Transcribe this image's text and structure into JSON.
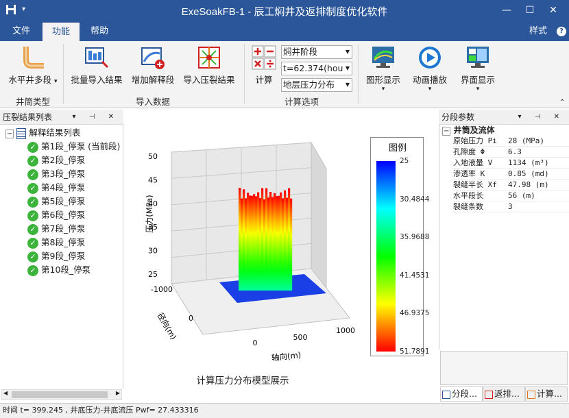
{
  "window": {
    "title": "ExeSoakFB-1 - 辰工焖井及返排制度优化软件",
    "minimize": "—",
    "maximize": "☐",
    "close": "✕",
    "help": "?"
  },
  "menu": {
    "file": "文件",
    "function": "功能",
    "help": "帮助",
    "style": "样式"
  },
  "ribbon": {
    "well_multi": "水平井多段",
    "batch_import": "批量导入结果",
    "add_segment": "增加解释段",
    "import_frac": "导入压裂结果",
    "calc": "计算",
    "graph_show": "图形显示",
    "anim_play": "动画播放",
    "ui_show": "界面显示",
    "group_well_type": "井筒类型",
    "group_import": "导入数据",
    "group_calc_opts": "计算选项",
    "combo_stage": "焖井阶段",
    "combo_time": "t=62.374(hou",
    "combo_field": "地层压力分布"
  },
  "left_panel": {
    "title": "压裂结果列表",
    "root": "解释结果列表",
    "items": [
      "第1段_停泵 (当前段)",
      "第2段_停泵",
      "第3段_停泵",
      "第4段_停泵",
      "第5段_停泵",
      "第6段_停泵",
      "第7段_停泵",
      "第8段_停泵",
      "第9段_停泵",
      "第10段_停泵"
    ]
  },
  "chart_data": {
    "type": "surface3d",
    "title": "计算压力分布模型展示",
    "zlabel": "压力(MPa)",
    "xlabel": "轴向(m)",
    "ylabel": "径向(m)",
    "z_ticks": [
      "50",
      "45",
      "40",
      "35",
      "30",
      "25"
    ],
    "x_ticks": [
      "0",
      "500",
      "1000"
    ],
    "y_ticks": [
      "-1000",
      "0"
    ],
    "zlim": [
      25,
      51.7891
    ],
    "legend_title": "图例",
    "legend_values": [
      "25",
      "30.4844",
      "35.9688",
      "41.4531",
      "46.9375",
      "51.7891"
    ],
    "colormap": [
      "#0000ff",
      "#00ffff",
      "#00ff00",
      "#ffff00",
      "#ff0000"
    ],
    "baseline_color": "#1a3fe6",
    "peak_pressure": 51.7891,
    "base_pressure": 25
  },
  "right_panel": {
    "title": "分段参数",
    "section": "井筒及流体",
    "rows": [
      {
        "name": "原始压力 Pi",
        "value": "28 (MPa)"
      },
      {
        "name": "孔隙度 Φ",
        "value": "6.3"
      },
      {
        "name": "入地液量 V",
        "value": "1134 (m³)"
      },
      {
        "name": "渗透率 K",
        "value": "0.85 (md)"
      },
      {
        "name": "裂缝半长 Xf",
        "value": "47.98 (m)"
      },
      {
        "name": "水平段长",
        "value": "56 (m)"
      },
      {
        "name": "裂缝条数",
        "value": "3"
      }
    ],
    "tabs": [
      "分段...",
      "返排...",
      "计算..."
    ]
  },
  "status": {
    "text": "时间 t= 399.245 , 井底压力-井底流压 Pwf= 27.433316"
  }
}
